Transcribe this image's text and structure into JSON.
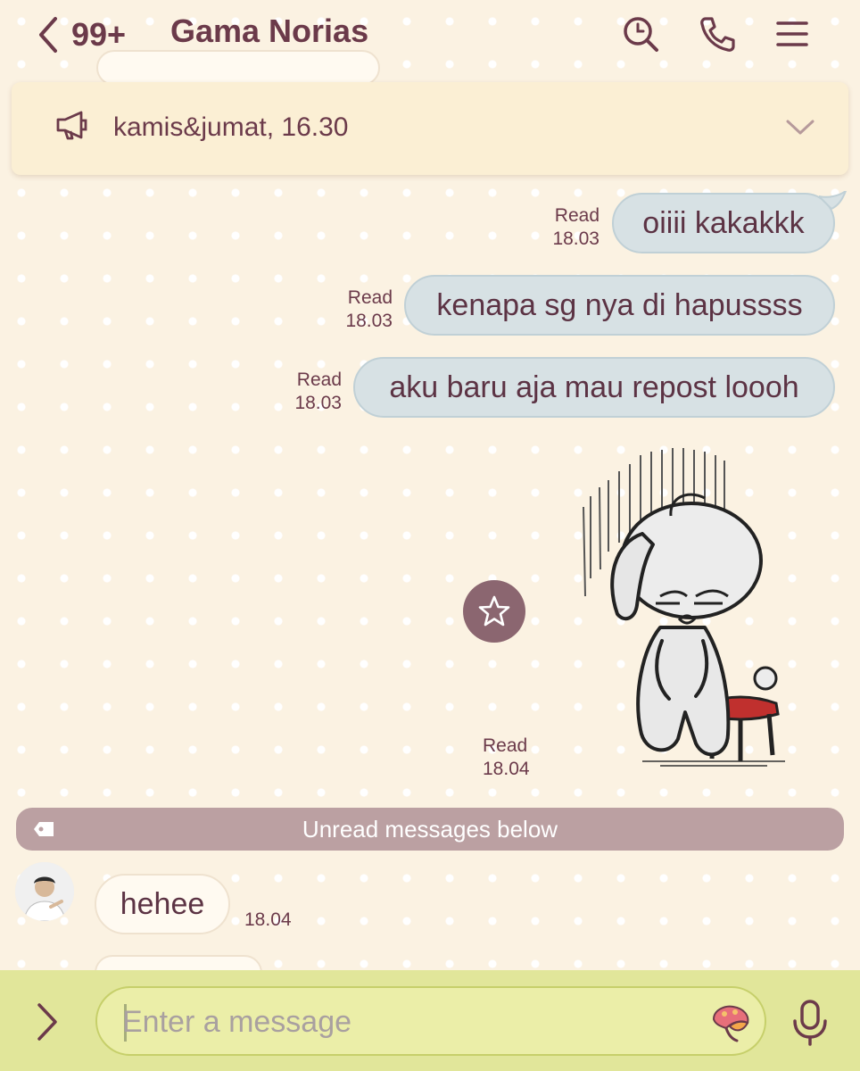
{
  "header": {
    "badge": "99+",
    "title": "Gama Norias",
    "icons": [
      "back-chevron-icon",
      "search-icon",
      "phone-icon",
      "menu-icon"
    ]
  },
  "announcement": {
    "text": "kamis&jumat, 16.30",
    "icons": [
      "megaphone-icon",
      "chevron-down-icon"
    ]
  },
  "messages_out": [
    {
      "text": "oiiii kakakkk",
      "status": "Read",
      "time": "18.03"
    },
    {
      "text": "kenapa sg nya di hapussss",
      "status": "Read",
      "time": "18.03"
    },
    {
      "text": "aku baru aja mau repost loooh",
      "status": "Read",
      "time": "18.03"
    }
  ],
  "sticker": {
    "status": "Read",
    "time": "18.04",
    "icon": "sad-rabbit-sticker"
  },
  "unread_divider": {
    "label": "Unread messages below"
  },
  "messages_in": [
    {
      "text": "hehee",
      "time": "18.04"
    }
  ],
  "composer": {
    "placeholder": "Enter a message",
    "icons": [
      "chevron-right-icon",
      "emoji-icon",
      "microphone-icon"
    ]
  },
  "colors": {
    "accent": "#6b3a4a",
    "background": "#fbf2e2",
    "outgoing_bubble": "#d7e1e4",
    "incoming_bubble": "#fffaf1",
    "composer_bg": "#e1e69a",
    "unread_bar": "#bba0a2"
  }
}
